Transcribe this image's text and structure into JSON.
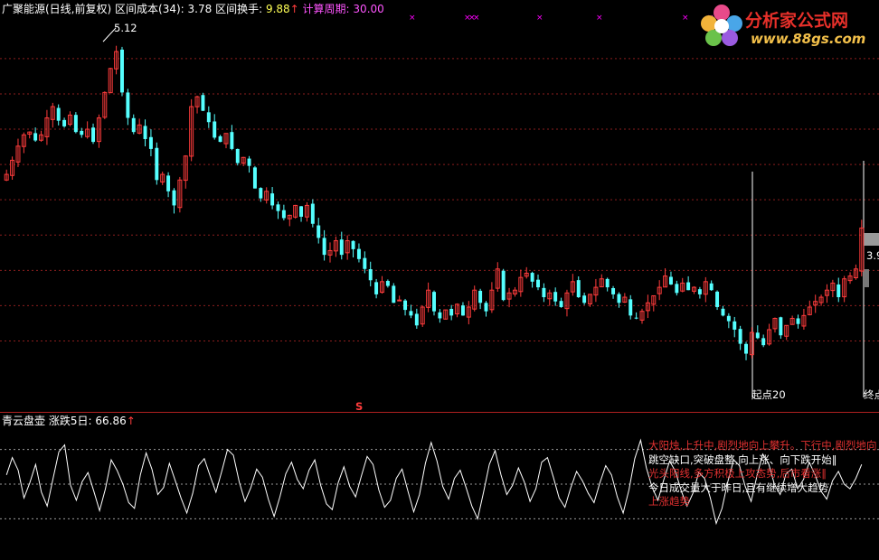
{
  "main_panel": {
    "stock_name": "广聚能源(日线,前复权)",
    "interval_cost_label": "区间成本(34)",
    "interval_cost_value": "3.78",
    "interval_turnover_label": "区间换手:",
    "interval_turnover_value": "9.88",
    "calc_period_label": "计算周期:",
    "calc_period_value": "30.00",
    "high_annotation": "5.12",
    "start_label": "起点20",
    "end_label": "终点",
    "right_price_label": "3.9",
    "s_marker": "S"
  },
  "sub_panel": {
    "indicator_name": "青云盘壶",
    "change_label": "涨跌5日:",
    "change_value": "66.86",
    "notes": [
      {
        "text": "大阳烛,上升中,剧烈地向上攀升。下行中,剧烈地向",
        "color": "#e03030"
      },
      {
        "text": "跳空缺口,突破盘整,向上涨、向下跌开始‖",
        "color": "#ffffff"
      },
      {
        "text": "光头阳线,多方积极上攻态势,后市看涨‖",
        "color": "#e03030"
      },
      {
        "text": "今日成交量大于昨日,且有继续增大趋势",
        "color": "#ffffff"
      },
      {
        "text": "上涨趋势",
        "color": "#e03030"
      }
    ]
  },
  "watermark": {
    "title": "分析家公式网",
    "url": "www.88gs.com"
  },
  "colors": {
    "up": "#ff3c3c",
    "down": "#55ffff",
    "grid": "#8b1e1e",
    "line": "#ffffff",
    "marker": "#ff00ff"
  },
  "chart_data": [
    {
      "type": "candlestick",
      "title": "广聚能源(日线,前复权)",
      "ylim": [
        2.6,
        5.3
      ],
      "y_gridlines": [
        3.0,
        3.25,
        3.5,
        3.75,
        4.0,
        4.25,
        4.5,
        4.75,
        5.0
      ],
      "closes": [
        4.18,
        4.28,
        4.38,
        4.46,
        4.48,
        4.42,
        4.46,
        4.58,
        4.66,
        4.56,
        4.52,
        4.6,
        4.48,
        4.46,
        4.5,
        4.41,
        4.58,
        4.76,
        4.93,
        5.05,
        4.76,
        4.58,
        4.48,
        4.53,
        4.43,
        4.36,
        4.14,
        4.18,
        4.06,
        3.96,
        4.14,
        4.31,
        4.66,
        4.73,
        4.63,
        4.55,
        4.44,
        4.41,
        4.47,
        4.36,
        4.26,
        4.3,
        4.24,
        4.08,
        4.01,
        4.06,
        3.96,
        3.92,
        3.87,
        3.89,
        3.96,
        3.88,
        3.96,
        3.83,
        3.73,
        3.61,
        3.64,
        3.71,
        3.61,
        3.71,
        3.65,
        3.58,
        3.51,
        3.43,
        3.33,
        3.42,
        3.39,
        3.27,
        3.29,
        3.22,
        3.18,
        3.11,
        3.24,
        3.36,
        3.21,
        3.16,
        3.22,
        3.18,
        3.26,
        3.18,
        3.24,
        3.36,
        3.27,
        3.21,
        3.36,
        3.51,
        3.29,
        3.34,
        3.36,
        3.45,
        3.48,
        3.42,
        3.38,
        3.31,
        3.34,
        3.28,
        3.24,
        3.34,
        3.42,
        3.31,
        3.27,
        3.33,
        3.38,
        3.44,
        3.38,
        3.33,
        3.27,
        3.31,
        3.18,
        3.16,
        3.21,
        3.27,
        3.32,
        3.38,
        3.46,
        3.4,
        3.34,
        3.41,
        3.36,
        3.38,
        3.33,
        3.42,
        3.36,
        3.24,
        3.18,
        3.14,
        3.08,
        2.98,
        2.91,
        3.06,
        3.02,
        2.97,
        3.08,
        3.16,
        3.04,
        3.11,
        3.16,
        3.12,
        3.18,
        3.24,
        3.28,
        3.31,
        3.36,
        3.41,
        3.31,
        3.44,
        3.46,
        3.51,
        3.8
      ],
      "annotations": [
        "5.12",
        "起点20",
        "终点",
        "3.9"
      ]
    },
    {
      "type": "line",
      "title": "青云盘壶",
      "series": [
        {
          "name": "涨跌5日",
          "last_value": 66.86
        }
      ],
      "ylim": [
        0,
        100
      ],
      "reference_lines": [
        20,
        50,
        80
      ],
      "values": [
        58,
        73,
        62,
        38,
        51,
        67,
        43,
        31,
        55,
        78,
        84,
        49,
        36,
        52,
        60,
        44,
        27,
        46,
        71,
        62,
        50,
        34,
        29,
        58,
        77,
        63,
        41,
        47,
        68,
        53,
        38,
        25,
        42,
        66,
        72,
        57,
        43,
        61,
        80,
        75,
        52,
        35,
        47,
        63,
        56,
        37,
        22,
        39,
        59,
        69,
        54,
        46,
        62,
        71,
        49,
        33,
        28,
        51,
        65,
        48,
        39,
        57,
        74,
        67,
        45,
        30,
        36,
        55,
        63,
        44,
        26,
        41,
        68,
        86,
        70,
        48,
        37,
        55,
        62,
        47,
        31,
        20,
        43,
        67,
        79,
        58,
        41,
        49,
        64,
        52,
        35,
        46,
        69,
        73,
        56,
        38,
        30,
        47,
        61,
        53,
        42,
        34,
        51,
        66,
        58,
        39,
        25,
        45,
        72,
        88,
        64,
        47,
        36,
        54,
        70,
        61,
        44,
        31,
        42,
        60,
        55,
        38,
        16,
        29,
        52,
        71,
        66,
        48,
        35,
        57,
        76,
        68,
        50,
        41,
        59,
        63,
        46,
        54,
        69,
        58,
        44,
        37,
        53,
        61,
        50,
        46,
        55,
        67
      ]
    }
  ]
}
